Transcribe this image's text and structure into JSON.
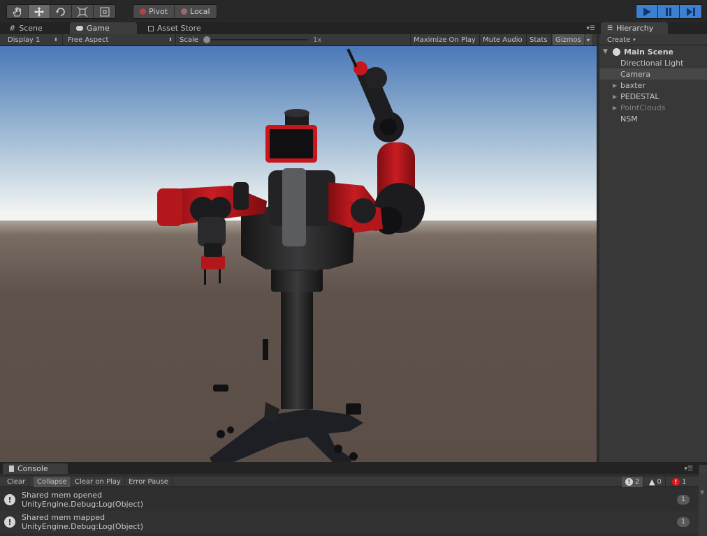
{
  "toolbar": {
    "tools": [
      {
        "icon": "hand-icon"
      },
      {
        "icon": "move-icon"
      },
      {
        "icon": "rotate-icon"
      },
      {
        "icon": "scale-icon"
      },
      {
        "icon": "rect-icon"
      }
    ],
    "pivot_label": "Pivot",
    "local_label": "Local",
    "play_icon": "play-icon",
    "pause_icon": "pause-icon",
    "step_icon": "step-icon"
  },
  "tabs": {
    "scene": "Scene",
    "game": "Game",
    "asset_store": "Asset Store",
    "hierarchy": "Hierarchy",
    "console": "Console"
  },
  "game_bar": {
    "display": "Display 1",
    "aspect": "Free Aspect",
    "scale_label": "Scale",
    "scale_value": "1x",
    "scale_fraction": 0.0,
    "maximize": "Maximize On Play",
    "mute": "Mute Audio",
    "stats": "Stats",
    "gizmos": "Gizmos"
  },
  "hierarchy": {
    "create_label": "Create",
    "scene_name": "Main Scene",
    "items": [
      {
        "label": "Directional Light",
        "expandable": false,
        "selected": false,
        "dim": false
      },
      {
        "label": "Camera",
        "expandable": false,
        "selected": true,
        "dim": false
      },
      {
        "label": "baxter",
        "expandable": true,
        "selected": false,
        "dim": false
      },
      {
        "label": "PEDESTAL",
        "expandable": true,
        "selected": false,
        "dim": false
      },
      {
        "label": "PointClouds",
        "expandable": true,
        "selected": false,
        "dim": true
      },
      {
        "label": "NSM",
        "expandable": false,
        "selected": false,
        "dim": false
      }
    ]
  },
  "console": {
    "clear": "Clear",
    "collapse": "Collapse",
    "clear_on_play": "Clear on Play",
    "error_pause": "Error Pause",
    "info_count": "2",
    "warning_count": "0",
    "error_count": "1",
    "logs": [
      {
        "message": "Shared mem opened",
        "source": "UnityEngine.Debug:Log(Object)",
        "count": "1"
      },
      {
        "message": "Shared mem mapped",
        "source": "UnityEngine.Debug:Log(Object)",
        "count": "1"
      }
    ]
  },
  "colors": {
    "accent": "#3d7fd0",
    "robot_red": "#c0171d",
    "sky_top": "#4a78b8",
    "ground": "#5d5048"
  }
}
